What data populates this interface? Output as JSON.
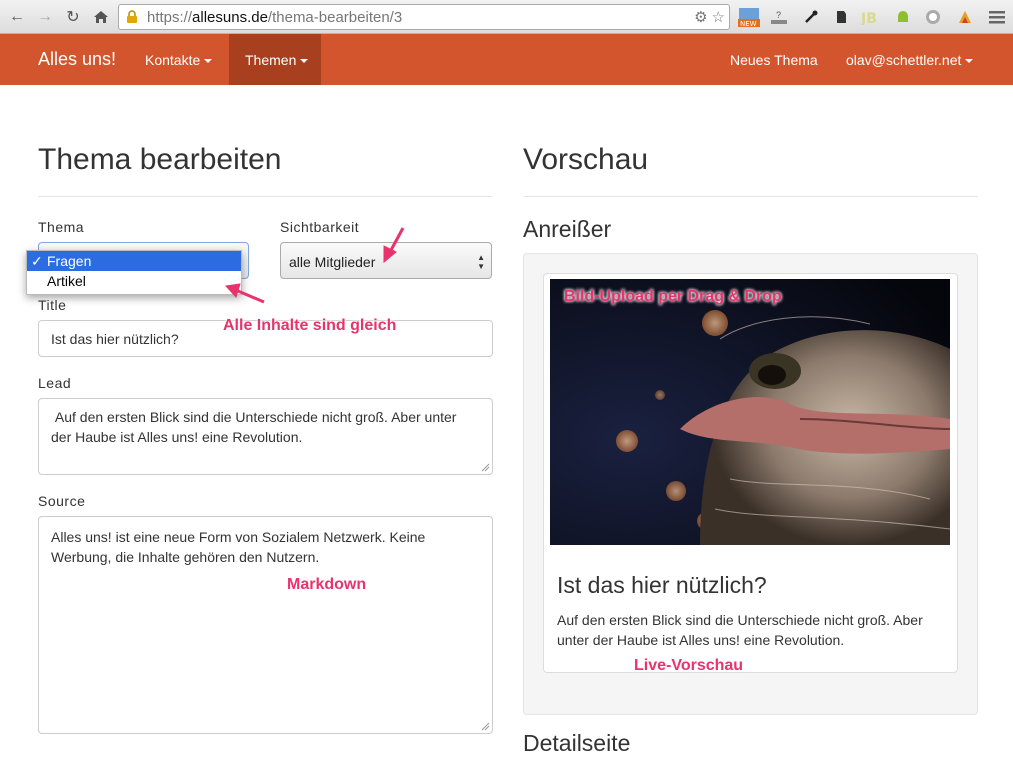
{
  "browser": {
    "url_scheme": "https://",
    "url_domain": "allesuns.de",
    "url_path": "/thema-bearbeiten/3"
  },
  "navbar": {
    "brand": "Alles uns!",
    "kontakte": "Kontakte",
    "themen": "Themen",
    "neues_thema": "Neues Thema",
    "user": "olav@schettler.net"
  },
  "form": {
    "heading": "Thema bearbeiten",
    "thema_label": "Thema",
    "thema_options": [
      "Fragen",
      "Artikel"
    ],
    "thema_check": "✓",
    "sichtbarkeit_label": "Sichtbarkeit",
    "sichtbarkeit_value": "alle Mitglieder",
    "title_label": "Title",
    "title_value": "Ist das hier nützlich?",
    "lead_label": "Lead",
    "lead_value": " Auf den ersten Blick sind die Unterschiede nicht groß. Aber unter der Haube ist Alles uns! eine Revolution.",
    "source_label": "Source",
    "source_value": "Alles uns! ist eine neue Form von Sozialem Netzwerk. Keine Werbung, die Inhalte gehören den Nutzern."
  },
  "preview": {
    "heading": "Vorschau",
    "teaser_heading": "Anreißer",
    "card_title": "Ist das hier nützlich?",
    "card_text": "Auf den ersten Blick sind die Unterschiede nicht groß. Aber unter der Haube ist Alles uns! eine Revolution.",
    "detail_heading": "Detailseite"
  },
  "annotations": {
    "bild_upload": "Bild-Upload per Drag & Drop",
    "alle_inhalte": "Alle Inhalte sind gleich",
    "markdown": "Markdown",
    "live_vorschau": "Live-Vorschau"
  },
  "colors": {
    "navbar": "#d2552d",
    "navbar_active": "#a8401f",
    "annotation": "#e8336d",
    "dropdown_selected": "#2b6de0"
  }
}
